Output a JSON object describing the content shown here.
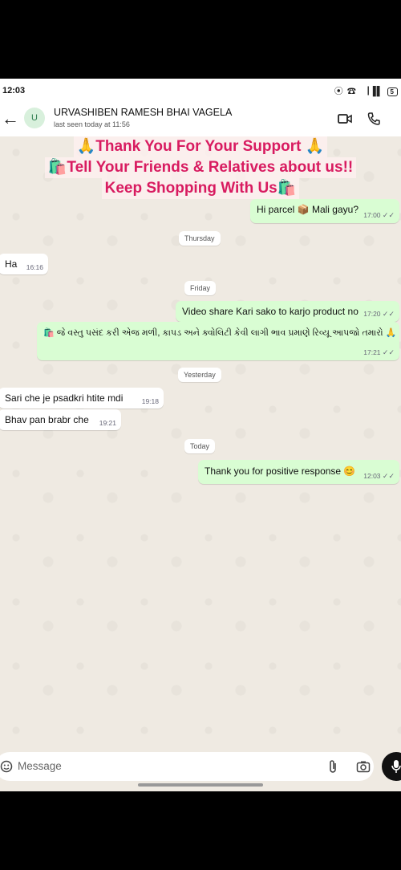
{
  "status_bar": {
    "time": "12:03",
    "icons": "⦿ ☎ ▕▐▌",
    "battery": "5"
  },
  "header": {
    "avatar_letter": "U",
    "contact_name": "URVASHIBEN RAMESH BHAI VAGELA",
    "last_seen": "last seen today at 11:56",
    "back_icon": "←",
    "menu_icon": "⋮"
  },
  "banner": {
    "line1": "🙏Thank You For Your Support 🙏",
    "line2": "🛍️Tell Your Friends & Relatives about us!!",
    "line3": "Keep Shopping With Us🛍️"
  },
  "messages": [
    {
      "text": "Hi parcel 📦 Mali gayu?",
      "time": "17:00",
      "dir": "out"
    },
    {
      "date": "Thursday"
    },
    {
      "text": "Ha",
      "time": "16:16",
      "dir": "in"
    },
    {
      "date": "Friday"
    },
    {
      "text": "Video share Kari sako to karjo product no",
      "time": "17:20",
      "dir": "out"
    },
    {
      "text": "🛍️ જે વસ્તુ પસંદ કરી એજ મળી, કાપડ અને ક્વોલિટી કેવી લાગી ભાવ પ્રમાણે રિવ્યૂ આપજો તમારો 🙏",
      "time": "17:21",
      "dir": "out"
    },
    {
      "date": "Yesterday"
    },
    {
      "text": "Sari che  je psadkri  htite mdi",
      "time": "19:18",
      "dir": "in"
    },
    {
      "text": "Bhav pan brabr che",
      "time": "19:21",
      "dir": "in"
    },
    {
      "date": "Today"
    },
    {
      "text": "Thank you for positive response 😊",
      "time": "12:03",
      "dir": "out"
    }
  ],
  "input": {
    "placeholder": "Message"
  },
  "colors": {
    "outgoing": "#d9fdd3",
    "incoming": "#ffffff",
    "banner_text": "#d81b60",
    "chat_bg": "#efeae2"
  }
}
